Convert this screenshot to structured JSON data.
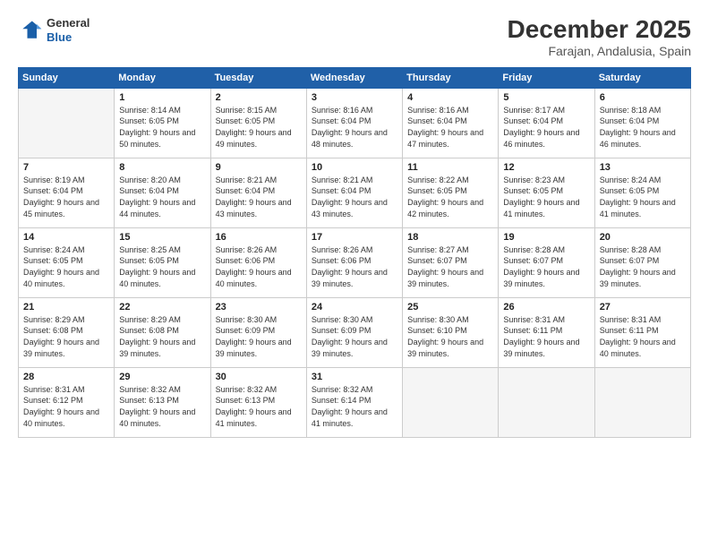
{
  "header": {
    "logo_line1": "General",
    "logo_line2": "Blue",
    "title": "December 2025",
    "subtitle": "Farajan, Andalusia, Spain"
  },
  "calendar": {
    "days_of_week": [
      "Sunday",
      "Monday",
      "Tuesday",
      "Wednesday",
      "Thursday",
      "Friday",
      "Saturday"
    ],
    "weeks": [
      [
        {
          "day": "",
          "empty": true
        },
        {
          "day": "1",
          "sunrise": "8:14 AM",
          "sunset": "6:05 PM",
          "daylight": "9 hours and 50 minutes."
        },
        {
          "day": "2",
          "sunrise": "8:15 AM",
          "sunset": "6:05 PM",
          "daylight": "9 hours and 49 minutes."
        },
        {
          "day": "3",
          "sunrise": "8:16 AM",
          "sunset": "6:04 PM",
          "daylight": "9 hours and 48 minutes."
        },
        {
          "day": "4",
          "sunrise": "8:16 AM",
          "sunset": "6:04 PM",
          "daylight": "9 hours and 47 minutes."
        },
        {
          "day": "5",
          "sunrise": "8:17 AM",
          "sunset": "6:04 PM",
          "daylight": "9 hours and 46 minutes."
        },
        {
          "day": "6",
          "sunrise": "8:18 AM",
          "sunset": "6:04 PM",
          "daylight": "9 hours and 46 minutes."
        }
      ],
      [
        {
          "day": "7",
          "sunrise": "8:19 AM",
          "sunset": "6:04 PM",
          "daylight": "9 hours and 45 minutes."
        },
        {
          "day": "8",
          "sunrise": "8:20 AM",
          "sunset": "6:04 PM",
          "daylight": "9 hours and 44 minutes."
        },
        {
          "day": "9",
          "sunrise": "8:21 AM",
          "sunset": "6:04 PM",
          "daylight": "9 hours and 43 minutes."
        },
        {
          "day": "10",
          "sunrise": "8:21 AM",
          "sunset": "6:04 PM",
          "daylight": "9 hours and 43 minutes."
        },
        {
          "day": "11",
          "sunrise": "8:22 AM",
          "sunset": "6:05 PM",
          "daylight": "9 hours and 42 minutes."
        },
        {
          "day": "12",
          "sunrise": "8:23 AM",
          "sunset": "6:05 PM",
          "daylight": "9 hours and 41 minutes."
        },
        {
          "day": "13",
          "sunrise": "8:24 AM",
          "sunset": "6:05 PM",
          "daylight": "9 hours and 41 minutes."
        }
      ],
      [
        {
          "day": "14",
          "sunrise": "8:24 AM",
          "sunset": "6:05 PM",
          "daylight": "9 hours and 40 minutes."
        },
        {
          "day": "15",
          "sunrise": "8:25 AM",
          "sunset": "6:05 PM",
          "daylight": "9 hours and 40 minutes."
        },
        {
          "day": "16",
          "sunrise": "8:26 AM",
          "sunset": "6:06 PM",
          "daylight": "9 hours and 40 minutes."
        },
        {
          "day": "17",
          "sunrise": "8:26 AM",
          "sunset": "6:06 PM",
          "daylight": "9 hours and 39 minutes."
        },
        {
          "day": "18",
          "sunrise": "8:27 AM",
          "sunset": "6:07 PM",
          "daylight": "9 hours and 39 minutes."
        },
        {
          "day": "19",
          "sunrise": "8:28 AM",
          "sunset": "6:07 PM",
          "daylight": "9 hours and 39 minutes."
        },
        {
          "day": "20",
          "sunrise": "8:28 AM",
          "sunset": "6:07 PM",
          "daylight": "9 hours and 39 minutes."
        }
      ],
      [
        {
          "day": "21",
          "sunrise": "8:29 AM",
          "sunset": "6:08 PM",
          "daylight": "9 hours and 39 minutes."
        },
        {
          "day": "22",
          "sunrise": "8:29 AM",
          "sunset": "6:08 PM",
          "daylight": "9 hours and 39 minutes."
        },
        {
          "day": "23",
          "sunrise": "8:30 AM",
          "sunset": "6:09 PM",
          "daylight": "9 hours and 39 minutes."
        },
        {
          "day": "24",
          "sunrise": "8:30 AM",
          "sunset": "6:09 PM",
          "daylight": "9 hours and 39 minutes."
        },
        {
          "day": "25",
          "sunrise": "8:30 AM",
          "sunset": "6:10 PM",
          "daylight": "9 hours and 39 minutes."
        },
        {
          "day": "26",
          "sunrise": "8:31 AM",
          "sunset": "6:11 PM",
          "daylight": "9 hours and 39 minutes."
        },
        {
          "day": "27",
          "sunrise": "8:31 AM",
          "sunset": "6:11 PM",
          "daylight": "9 hours and 40 minutes."
        }
      ],
      [
        {
          "day": "28",
          "sunrise": "8:31 AM",
          "sunset": "6:12 PM",
          "daylight": "9 hours and 40 minutes."
        },
        {
          "day": "29",
          "sunrise": "8:32 AM",
          "sunset": "6:13 PM",
          "daylight": "9 hours and 40 minutes."
        },
        {
          "day": "30",
          "sunrise": "8:32 AM",
          "sunset": "6:13 PM",
          "daylight": "9 hours and 41 minutes."
        },
        {
          "day": "31",
          "sunrise": "8:32 AM",
          "sunset": "6:14 PM",
          "daylight": "9 hours and 41 minutes."
        },
        {
          "day": "",
          "empty": true
        },
        {
          "day": "",
          "empty": true
        },
        {
          "day": "",
          "empty": true
        }
      ]
    ]
  }
}
